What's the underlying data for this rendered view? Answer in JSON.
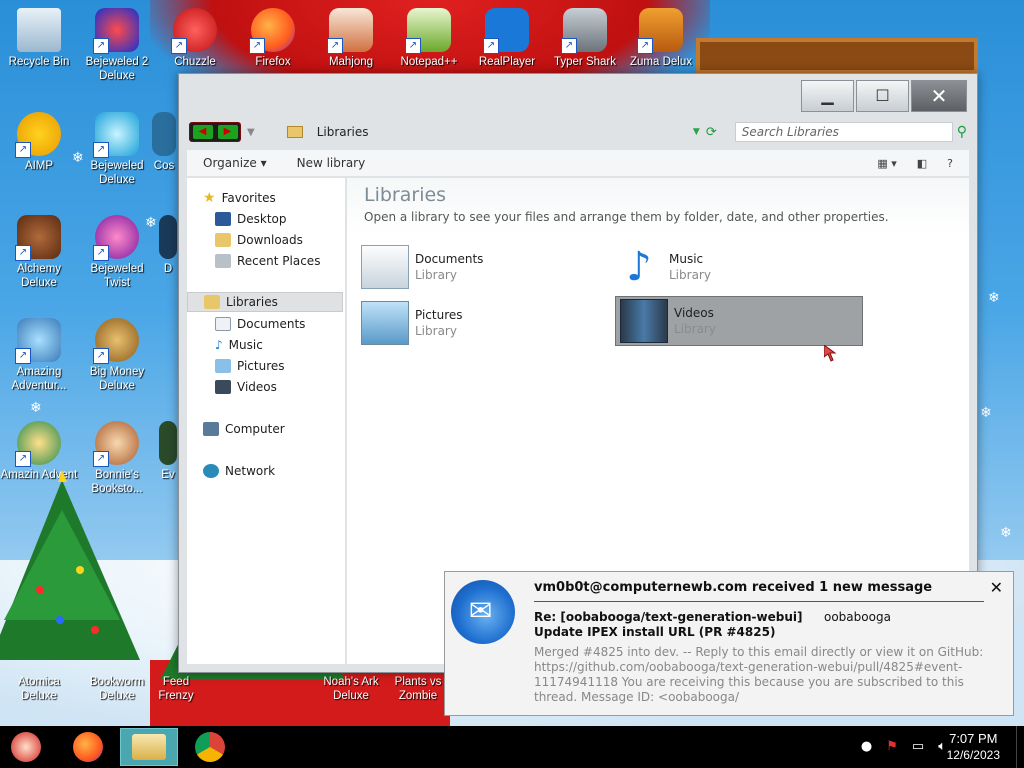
{
  "desktop": {
    "icons": [
      {
        "label": "Recycle Bin"
      },
      {
        "label": "Bejeweled 2 Deluxe"
      },
      {
        "label": "Chuzzle"
      },
      {
        "label": "Firefox"
      },
      {
        "label": "Mahjong"
      },
      {
        "label": "Notepad++"
      },
      {
        "label": "RealPlayer"
      },
      {
        "label": "Typer Shark"
      },
      {
        "label": "Zuma Delux"
      },
      {
        "label": "AIMP"
      },
      {
        "label": "Bejeweled Deluxe"
      },
      {
        "label": "Cos"
      },
      {
        "label": "Alchemy Deluxe"
      },
      {
        "label": "Bejeweled Twist"
      },
      {
        "label": "D"
      },
      {
        "label": "Amazing Adventur..."
      },
      {
        "label": "Big Money Deluxe"
      },
      {
        "label": "Amazin Advent"
      },
      {
        "label": "Bonnie's Booksto..."
      },
      {
        "label": "Ev"
      },
      {
        "label": "Atomica Deluxe"
      },
      {
        "label": "Bookworm Deluxe"
      },
      {
        "label": "Feed Frenzy"
      },
      {
        "label": "Noah's Ark Deluxe"
      },
      {
        "label": "Plants vs Zombie"
      }
    ]
  },
  "window": {
    "address": "Libraries",
    "search_placeholder": "Search Libraries",
    "toolbar": {
      "organize": "Organize",
      "new_library": "New library"
    },
    "nav": {
      "favorites": "Favorites",
      "desktop": "Desktop",
      "downloads": "Downloads",
      "recent": "Recent Places",
      "libraries": "Libraries",
      "documents": "Documents",
      "music": "Music",
      "pictures": "Pictures",
      "videos": "Videos",
      "computer": "Computer",
      "network": "Network"
    },
    "header": {
      "title": "Libraries",
      "subtitle": "Open a library to see your files and arrange them by folder, date, and other properties."
    },
    "libraries": [
      {
        "name": "Documents",
        "type": "Library"
      },
      {
        "name": "Music",
        "type": "Library"
      },
      {
        "name": "Pictures",
        "type": "Library"
      },
      {
        "name": "Videos",
        "type": "Library"
      }
    ]
  },
  "notification": {
    "header": "vm0b0t@computernewb.com received 1 new message",
    "subject": "Re: [oobabooga/text-generation-webui] Update IPEX install URL (PR #4825)",
    "from": "oobabooga",
    "body": "Merged #4825 into dev. -- Reply to this email directly or view it on GitHub: https://github.com/oobabooga/text-generation-webui/pull/4825#event-11174941118 You are receiving this because you are subscribed to this thread. Message ID: <oobabooga/"
  },
  "taskbar": {
    "time": "7:07 PM",
    "date": "12/6/2023"
  },
  "colors": {
    "selected_item": "#9fa2a5",
    "taskbar_active": "#4aa7b0",
    "sky": "#2a8fd8"
  }
}
